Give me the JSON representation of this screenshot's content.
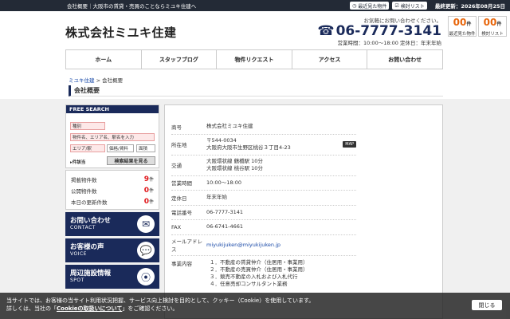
{
  "topbar": {
    "left_text": "会社概要｜大阪市の賃貸・売買のことならミユキ住建へ",
    "recent_label": "最近見た物件",
    "saved_label": "検討リスト",
    "date_text": "最終更新：2026年08月25日"
  },
  "header": {
    "logo": "株式会社ミユキ住建",
    "contact_note": "お気軽にお問い合わせください。",
    "phone": "06-7777-3141",
    "hours": "営業時間：10:00〜18:00 定休日：年末年始",
    "counts": [
      {
        "num": "00",
        "unit": "件",
        "label": "最近見た物件"
      },
      {
        "num": "00",
        "unit": "件",
        "label": "検討リスト"
      }
    ]
  },
  "nav": [
    "ホーム",
    "スタッフブログ",
    "物件リクエスト",
    "アクセス",
    "お問い合わせ"
  ],
  "breadcrumb": {
    "home": "ミユキ住建",
    "sep": ">",
    "current": "会社概要"
  },
  "page_title": "会社概要",
  "sidebar": {
    "search_title": "FREE SEARCH",
    "type_select": "種別",
    "keyword_placeholder": "物件名、エリア名、駅名を入力",
    "area_select": "エリア/駅",
    "price_select": "価格/賃料",
    "size_select": "面積",
    "count_label": "件該当",
    "search_button": "検索結果を見る",
    "stats": [
      {
        "label": "掲載物件数",
        "value": "9",
        "unit": "件"
      },
      {
        "label": "公開物件数",
        "value": "0",
        "unit": "件"
      },
      {
        "label": "本日の更新件数",
        "value": "0",
        "unit": "件"
      }
    ],
    "banners": [
      {
        "title": "お問い合わせ",
        "sub": "CONTACT",
        "icon": "✉"
      },
      {
        "title": "お客様の声",
        "sub": "VOICE",
        "icon": "💬"
      },
      {
        "title": "周辺施設情報",
        "sub": "SPOT",
        "icon": "⦿"
      }
    ]
  },
  "company": [
    {
      "key": "商号",
      "value": "株式会社ミユキ住建"
    },
    {
      "key": "所在地",
      "value": "〒544-0034",
      "value2": "大阪府大阪市生野区桃谷３丁目4-23",
      "map": "MAP"
    },
    {
      "key": "交通",
      "value": "大阪環状線 鶴橋駅 10分",
      "value2": "大阪環状線 桃谷駅 10分"
    },
    {
      "key": "営業時間",
      "value": "10:00〜18:00"
    },
    {
      "key": "定休日",
      "value": "年末年始"
    },
    {
      "key": "電話番号",
      "value": "06-7777-3141"
    },
    {
      "key": "FAX",
      "value": "06-6741-4661"
    },
    {
      "key": "メールアドレス",
      "value": "miyukijuken@miyukijuken.jp",
      "link": true
    },
    {
      "key": "事業内容",
      "value": "１．不動産の賃貸仲介（住居用・事業用）",
      "value2": "２．不動産の売買仲介（住居用・事業用）",
      "value3": "３．競売不動産の入札および入札代行",
      "value4": "４．任意売却コンサルタント業務"
    }
  ],
  "cookie": {
    "line1": "当サイトでは、お客様の当サイト利用状況把握、サービス向上検討を目的として、クッキー（Cookie）を使用しています。",
    "line2_a": "詳しくは、当社の「",
    "line2_link": "Cookieの取扱いについて",
    "line2_b": "」をご確認ください。",
    "close": "閉じる"
  }
}
